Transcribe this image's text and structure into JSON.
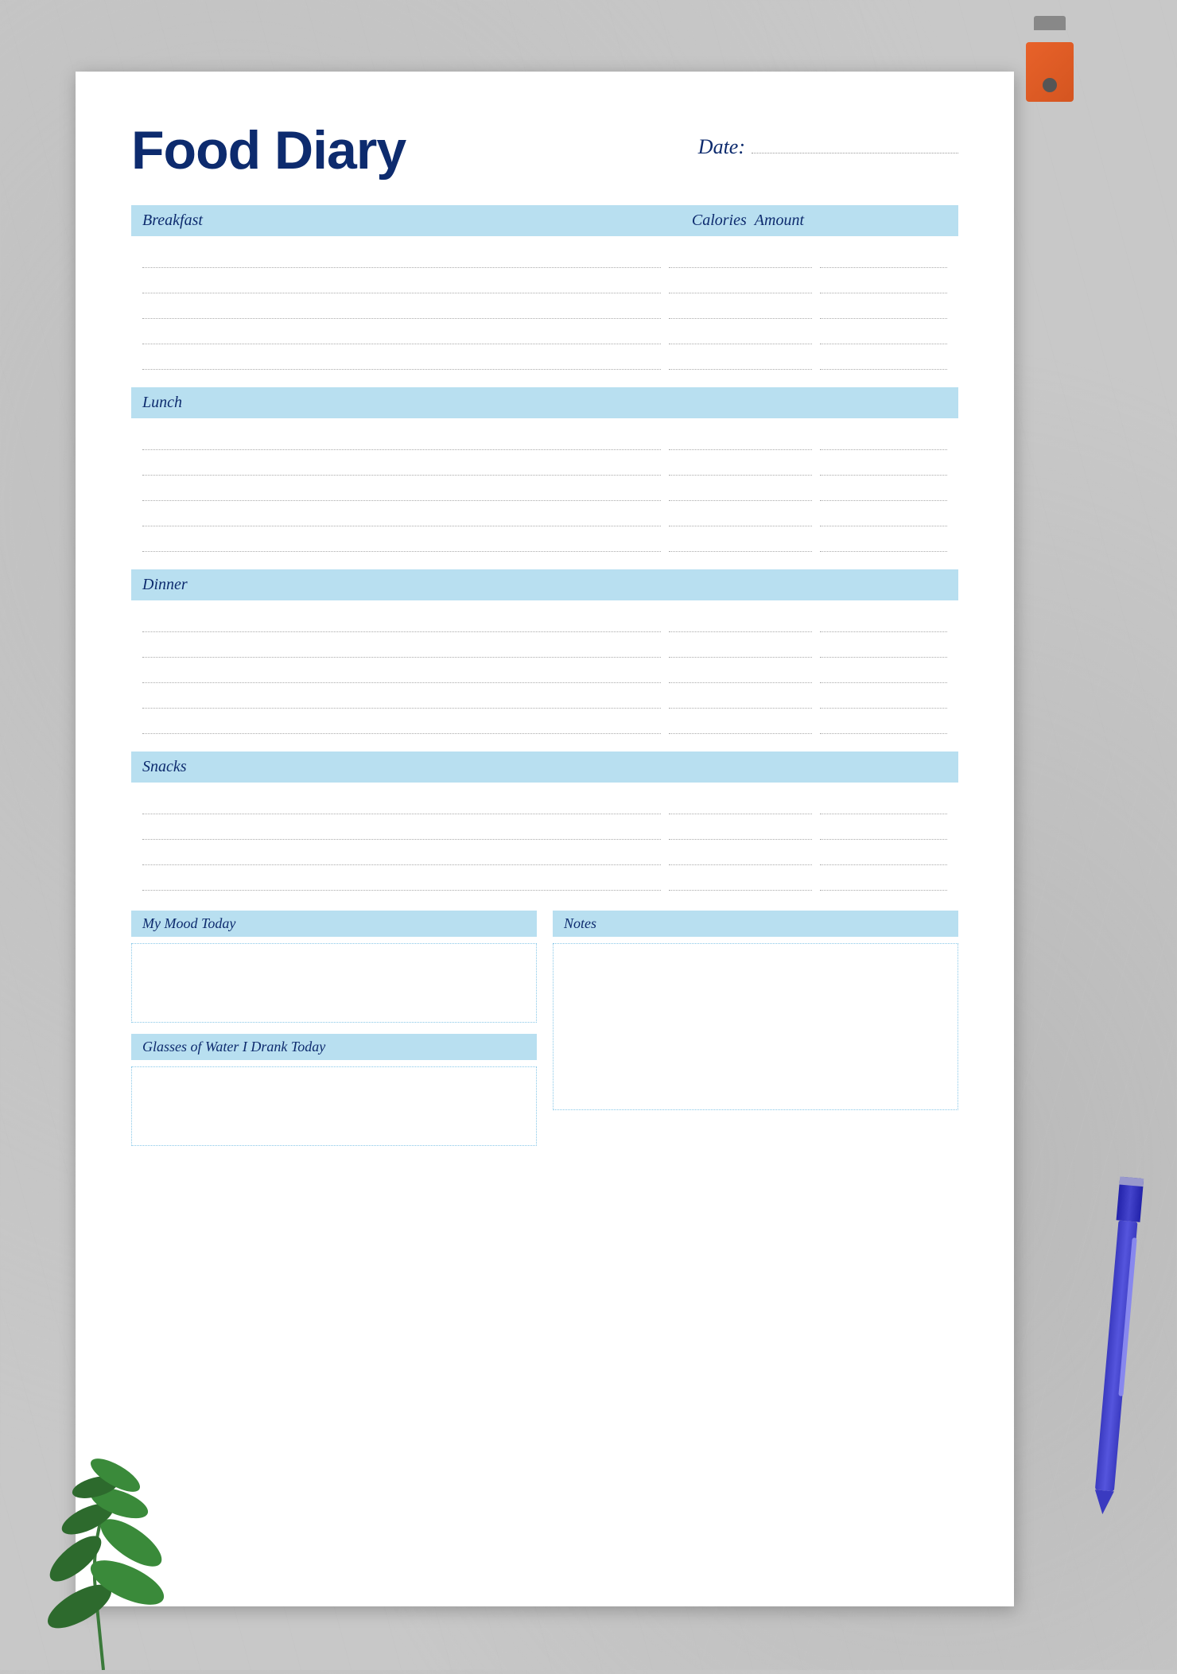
{
  "title": "Food Diary",
  "date": {
    "label": "Date:"
  },
  "sections": [
    {
      "id": "breakfast",
      "label": "Breakfast",
      "rows": 5
    },
    {
      "id": "lunch",
      "label": "Lunch",
      "rows": 5
    },
    {
      "id": "dinner",
      "label": "Dinner",
      "rows": 5
    },
    {
      "id": "snacks",
      "label": "Snacks",
      "rows": 4
    }
  ],
  "columns": {
    "amount": "Amount",
    "calories": "Calories"
  },
  "bottom": {
    "mood_label": "My Mood Today",
    "water_label": "Glasses of Water I Drank Today",
    "notes_label": "Notes"
  }
}
